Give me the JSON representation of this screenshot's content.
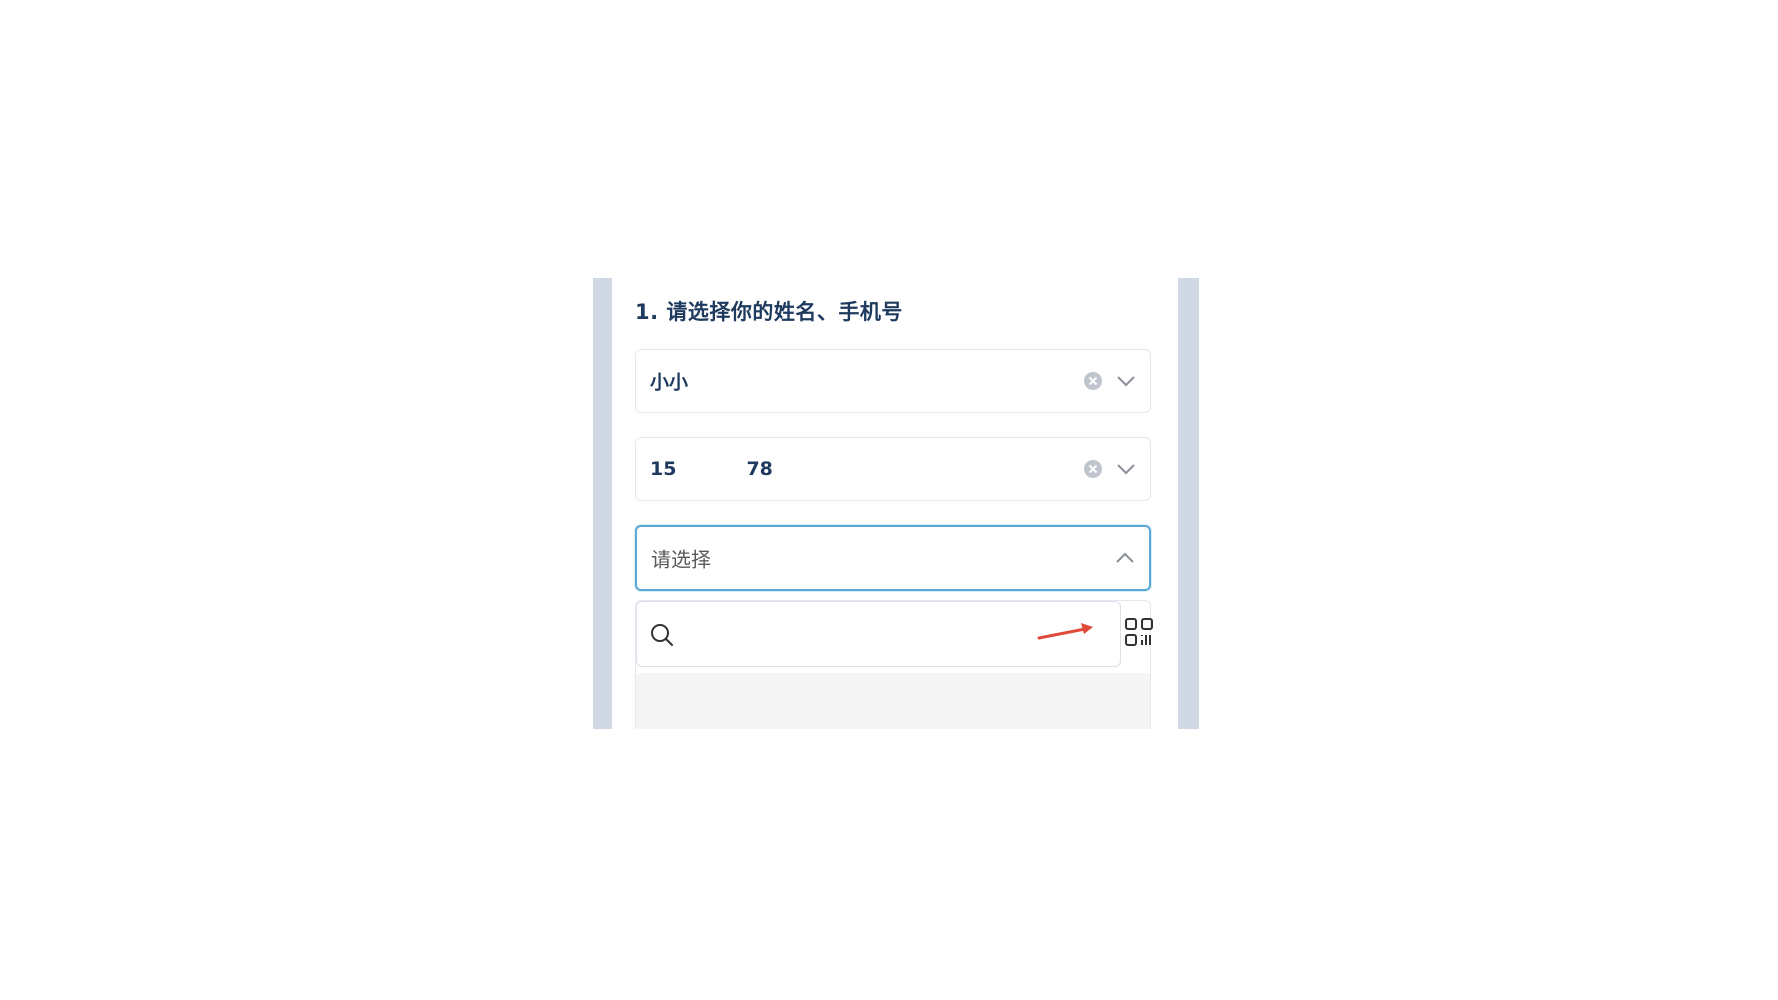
{
  "question": {
    "title": "1. 请选择你的姓名、手机号"
  },
  "fields": {
    "name": {
      "value": "小小",
      "clear_icon": "clear-circle-icon",
      "toggle_icon": "chevron-down-icon"
    },
    "phone": {
      "value_prefix": "15",
      "value_suffix": "78",
      "clear_icon": "clear-circle-icon",
      "toggle_icon": "chevron-down-icon"
    },
    "third": {
      "placeholder": "请选择",
      "toggle_icon": "chevron-up-icon"
    }
  },
  "dropdown": {
    "search_icon": "search-icon",
    "search_value": "",
    "scan_icon": "qr-scan-icon",
    "annotation": "red-arrow"
  },
  "colors": {
    "title": "#1e3a5f",
    "focus_border": "#5aa9d6",
    "annotation_arrow": "#e04a3a",
    "frame": "#cfd8e3"
  }
}
